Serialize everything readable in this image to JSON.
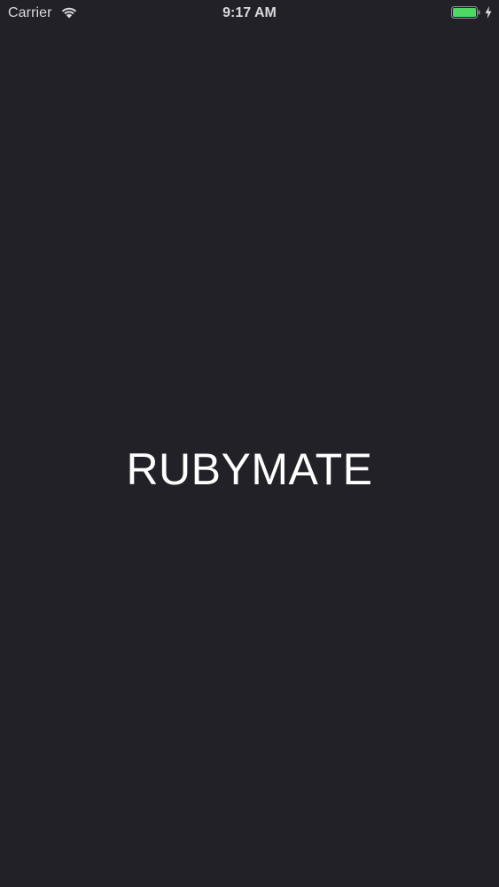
{
  "status_bar": {
    "carrier": "Carrier",
    "time": "9:17 AM",
    "battery_color": "#4cd964",
    "icons": [
      "wifi-icon",
      "battery-icon",
      "charging-bolt-icon"
    ]
  },
  "splash": {
    "title": "RUBYMATE",
    "background_color": "#222127",
    "text_color": "#ffffff"
  }
}
